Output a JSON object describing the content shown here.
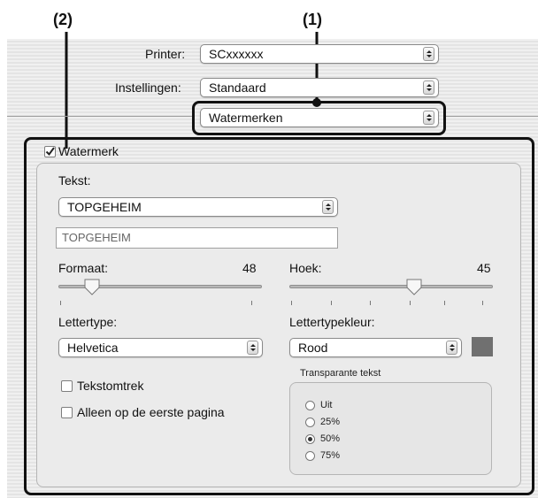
{
  "callouts": {
    "one": "(1)",
    "two": "(2)"
  },
  "printer": {
    "label": "Printer:",
    "value": "SCxxxxxx"
  },
  "settings": {
    "label": "Instellingen:",
    "value": "Standaard"
  },
  "panel": {
    "value": "Watermerken"
  },
  "watermark": {
    "checkbox_label": "Watermerk",
    "checked": true,
    "text_label": "Tekst:",
    "text_popup": "TOPGEHEIM",
    "text_field": "TOPGEHEIM",
    "size_label": "Formaat:",
    "size_value": "48",
    "angle_label": "Hoek:",
    "angle_value": "45",
    "font_label": "Lettertype:",
    "font_value": "Helvetica",
    "color_label": "Lettertypekleur:",
    "color_value": "Rood",
    "swatch_color": "#707070",
    "outline_label": "Tekstomtrek",
    "first_page_label": "Alleen op de eerste pagina",
    "transparency": {
      "title": "Transparante tekst",
      "options": [
        "Uit",
        "25%",
        "50%",
        "75%"
      ],
      "selected": "50%"
    }
  }
}
